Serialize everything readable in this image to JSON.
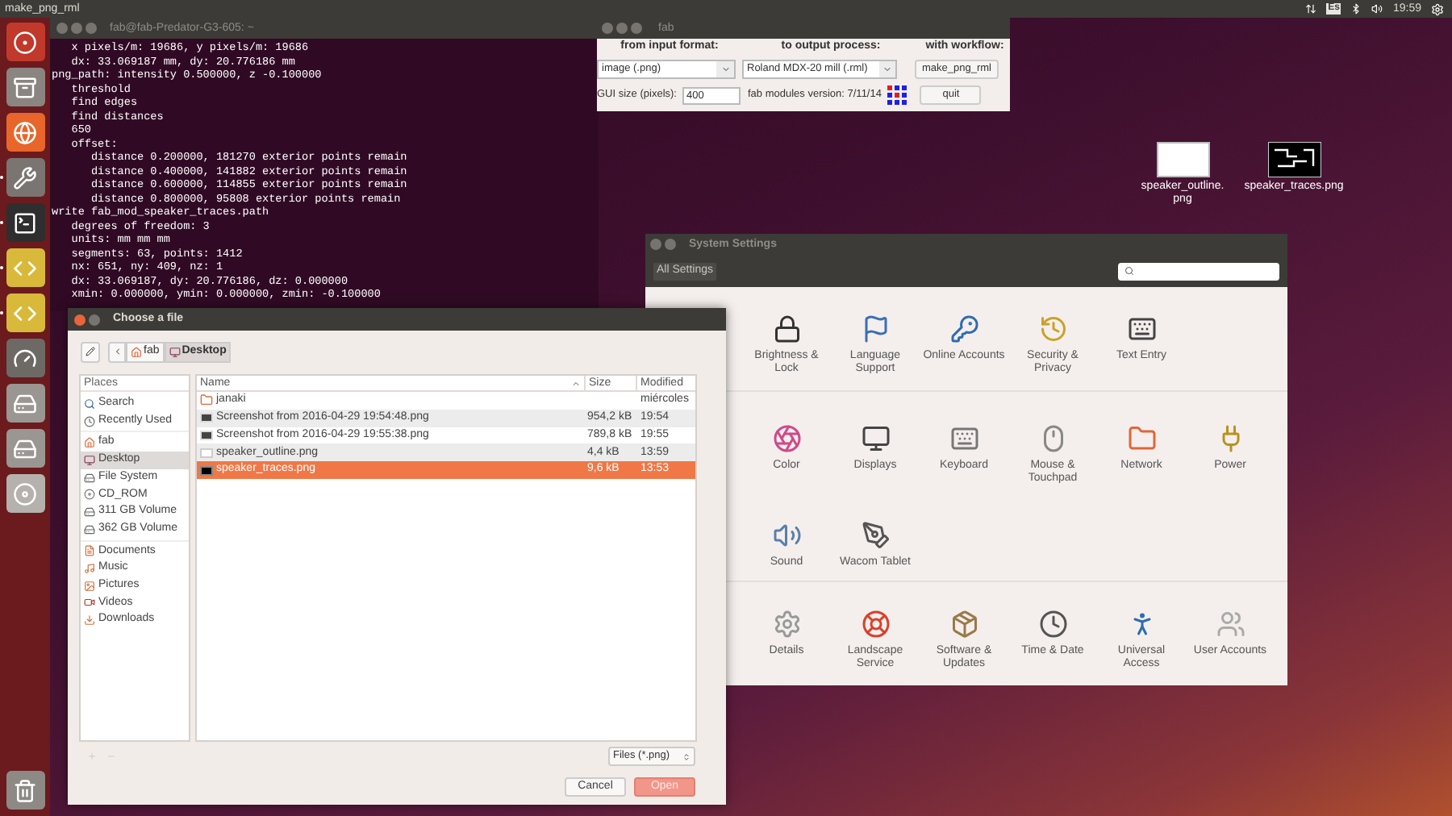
{
  "top_bar": {
    "title": "make_png_rml",
    "keyboard_layout": "Es",
    "clock": "19:59"
  },
  "launcher": [
    {
      "kind": "dash",
      "running": false
    },
    {
      "kind": "files",
      "running": false
    },
    {
      "kind": "browser",
      "running": false
    },
    {
      "kind": "settings",
      "running": true
    },
    {
      "kind": "terminal",
      "running": true
    },
    {
      "kind": "python",
      "running": true
    },
    {
      "kind": "python",
      "running": true
    },
    {
      "kind": "disk_usage",
      "running": false
    },
    {
      "kind": "drive",
      "running": false
    },
    {
      "kind": "drive",
      "running": false
    },
    {
      "kind": "dvd",
      "running": false
    },
    {
      "kind": "trash",
      "running": false
    }
  ],
  "terminal": {
    "title": "fab@fab-Predator-G3-605: ~",
    "lines": [
      "   x pixels/m: 19686, y pixels/m: 19686",
      "   dx: 33.069187 mm, dy: 20.776186 mm",
      "png_path: intensity 0.500000, z -0.100000",
      "   threshold",
      "   find edges",
      "   find distances",
      "   650",
      "   offset:",
      "      distance 0.200000, 181270 exterior points remain",
      "      distance 0.400000, 141882 exterior points remain",
      "      distance 0.600000, 114855 exterior points remain",
      "      distance 0.800000, 95808 exterior points remain",
      "write fab_mod_speaker_traces.path",
      "   degrees of freedom: 3",
      "   units: mm mm mm",
      "   segments: 63, points: 1412",
      "   nx: 651, ny: 409, nz: 1",
      "   dx: 33.069187, dy: 20.776186, dz: 0.000000",
      "   xmin: 0.000000, ymin: 0.000000, zmin: -0.100000"
    ]
  },
  "fab_window": {
    "title": "fab",
    "input_label": "from input format:",
    "output_label": "to output process:",
    "workflow_label": "with workflow:",
    "input_format": "image (.png)",
    "output_process": "Roland MDX-20 mill (.rml)",
    "workflow": "make_png_rml",
    "gui_size_label": "GUI size (pixels):",
    "gui_size": "400",
    "version": "fab modules version: 7/11/14",
    "quit": "quit"
  },
  "desktop_icons": [
    {
      "kind": "blank",
      "label": "speaker_outline.png"
    },
    {
      "kind": "traces",
      "label": "speaker_traces.png"
    }
  ],
  "system_settings": {
    "title": "System Settings",
    "all_settings": "All Settings",
    "sections": [
      {
        "items": [
          {
            "kind": "brightness",
            "label": "Brightness & Lock"
          },
          {
            "kind": "language",
            "label": "Language Support"
          },
          {
            "kind": "online",
            "label": "Online Accounts"
          },
          {
            "kind": "security",
            "label": "Security & Privacy"
          },
          {
            "kind": "text_entry",
            "label": "Text Entry"
          }
        ]
      },
      {
        "items": [
          {
            "kind": "color",
            "label": "Color"
          },
          {
            "kind": "displays",
            "label": "Displays"
          },
          {
            "kind": "keyboard",
            "label": "Keyboard"
          },
          {
            "kind": "mouse",
            "label": "Mouse & Touchpad"
          },
          {
            "kind": "network",
            "label": "Network"
          },
          {
            "kind": "power",
            "label": "Power"
          },
          {
            "kind": "sound",
            "label": "Sound"
          },
          {
            "kind": "wacom",
            "label": "Wacom Tablet"
          }
        ]
      },
      {
        "items": [
          {
            "kind": "details",
            "label": "Details"
          },
          {
            "kind": "landscape",
            "label": "Landscape Service"
          },
          {
            "kind": "software",
            "label": "Software & Updates"
          },
          {
            "kind": "time",
            "label": "Time & Date"
          },
          {
            "kind": "access",
            "label": "Universal Access"
          },
          {
            "kind": "users",
            "label": "User Accounts"
          }
        ]
      }
    ]
  },
  "file_dialog": {
    "title": "Choose a file",
    "path": [
      {
        "kind": "home",
        "label": "fab",
        "selected": false
      },
      {
        "kind": "desktop",
        "label": "Desktop",
        "selected": true
      }
    ],
    "places": {
      "header": "Places",
      "groups": [
        {
          "items": [
            {
              "kind": "search",
              "label": "Search",
              "selected": false
            },
            {
              "kind": "recent",
              "label": "Recently Used",
              "selected": false
            }
          ]
        },
        {
          "items": [
            {
              "kind": "home",
              "label": "fab",
              "selected": false
            },
            {
              "kind": "desktop",
              "label": "Desktop",
              "selected": true
            },
            {
              "kind": "drive",
              "label": "File System",
              "selected": false
            },
            {
              "kind": "disc",
              "label": "CD_ROM",
              "selected": false
            },
            {
              "kind": "drive",
              "label": "311 GB Volume",
              "selected": false
            },
            {
              "kind": "drive",
              "label": "362 GB Volume",
              "selected": false
            }
          ]
        },
        {
          "items": [
            {
              "kind": "documents",
              "label": "Documents",
              "selected": false
            },
            {
              "kind": "music",
              "label": "Music",
              "selected": false
            },
            {
              "kind": "pictures",
              "label": "Pictures",
              "selected": false
            },
            {
              "kind": "videos",
              "label": "Videos",
              "selected": false
            },
            {
              "kind": "downloads",
              "label": "Downloads",
              "selected": false
            }
          ]
        }
      ]
    },
    "columns": {
      "name": "Name",
      "size": "Size",
      "modified": "Modified"
    },
    "files": [
      {
        "kind": "folder",
        "name": "janaki",
        "modified": "miércoles",
        "selected": false
      },
      {
        "kind": "image",
        "name": "Screenshot from 2016-04-29 19:54:48.png",
        "size": "954,2 kB",
        "modified": "19:54",
        "selected": false
      },
      {
        "kind": "image",
        "name": "Screenshot from 2016-04-29 19:55:38.png",
        "size": "789,8 kB",
        "modified": "19:55",
        "selected": false
      },
      {
        "kind": "blank",
        "name": "speaker_outline.png",
        "size": "4,4 kB",
        "modified": "13:59",
        "selected": false
      },
      {
        "kind": "traces",
        "name": "speaker_traces.png",
        "size": "9,6 kB",
        "modified": "13:53",
        "selected": true
      }
    ],
    "filter": "Files (*.png)",
    "cancel": "Cancel",
    "open": "Open"
  }
}
